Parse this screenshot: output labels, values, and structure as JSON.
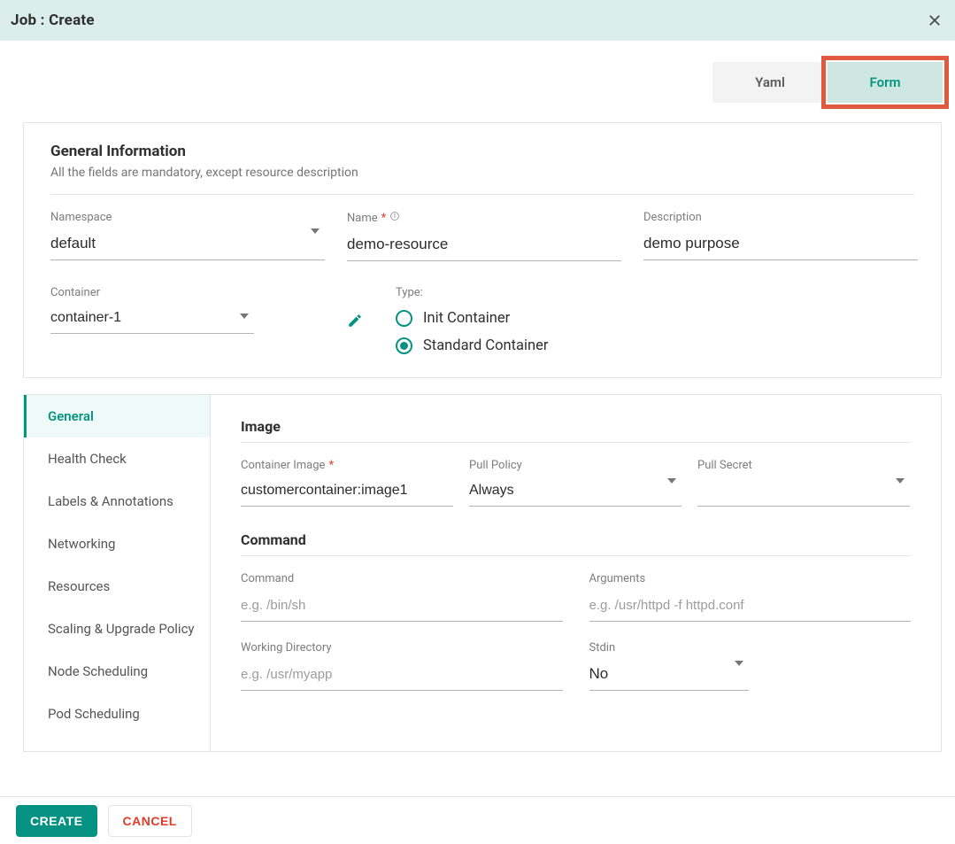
{
  "header": {
    "title": "Job : Create"
  },
  "tabs": {
    "yaml": "Yaml",
    "form": "Form",
    "active": "form"
  },
  "general": {
    "title": "General Information",
    "subtitle": "All the fields are mandatory, except resource description",
    "namespace": {
      "label": "Namespace",
      "value": "default"
    },
    "name": {
      "label": "Name",
      "value": "demo-resource",
      "required": true
    },
    "description": {
      "label": "Description",
      "value": "demo purpose"
    },
    "container": {
      "label": "Container",
      "value": "container-1"
    },
    "type": {
      "label": "Type:",
      "options": [
        "Init Container",
        "Standard Container"
      ],
      "selected": "Standard Container"
    }
  },
  "sidebar": {
    "items": [
      "General",
      "Health Check",
      "Labels & Annotations",
      "Networking",
      "Resources",
      "Scaling & Upgrade Policy",
      "Node Scheduling",
      "Pod Scheduling"
    ],
    "active": "General"
  },
  "image": {
    "title": "Image",
    "container_image": {
      "label": "Container Image",
      "value": "customercontainer:image1",
      "required": true
    },
    "pull_policy": {
      "label": "Pull Policy",
      "value": "Always"
    },
    "pull_secret": {
      "label": "Pull Secret",
      "value": ""
    }
  },
  "command": {
    "title": "Command",
    "cmd": {
      "label": "Command",
      "placeholder": "e.g. /bin/sh"
    },
    "args": {
      "label": "Arguments",
      "placeholder": "e.g. /usr/httpd -f httpd.conf"
    },
    "workdir": {
      "label": "Working Directory",
      "placeholder": "e.g. /usr/myapp"
    },
    "stdin": {
      "label": "Stdin",
      "value": "No"
    }
  },
  "footer": {
    "create": "CREATE",
    "cancel": "CANCEL"
  }
}
